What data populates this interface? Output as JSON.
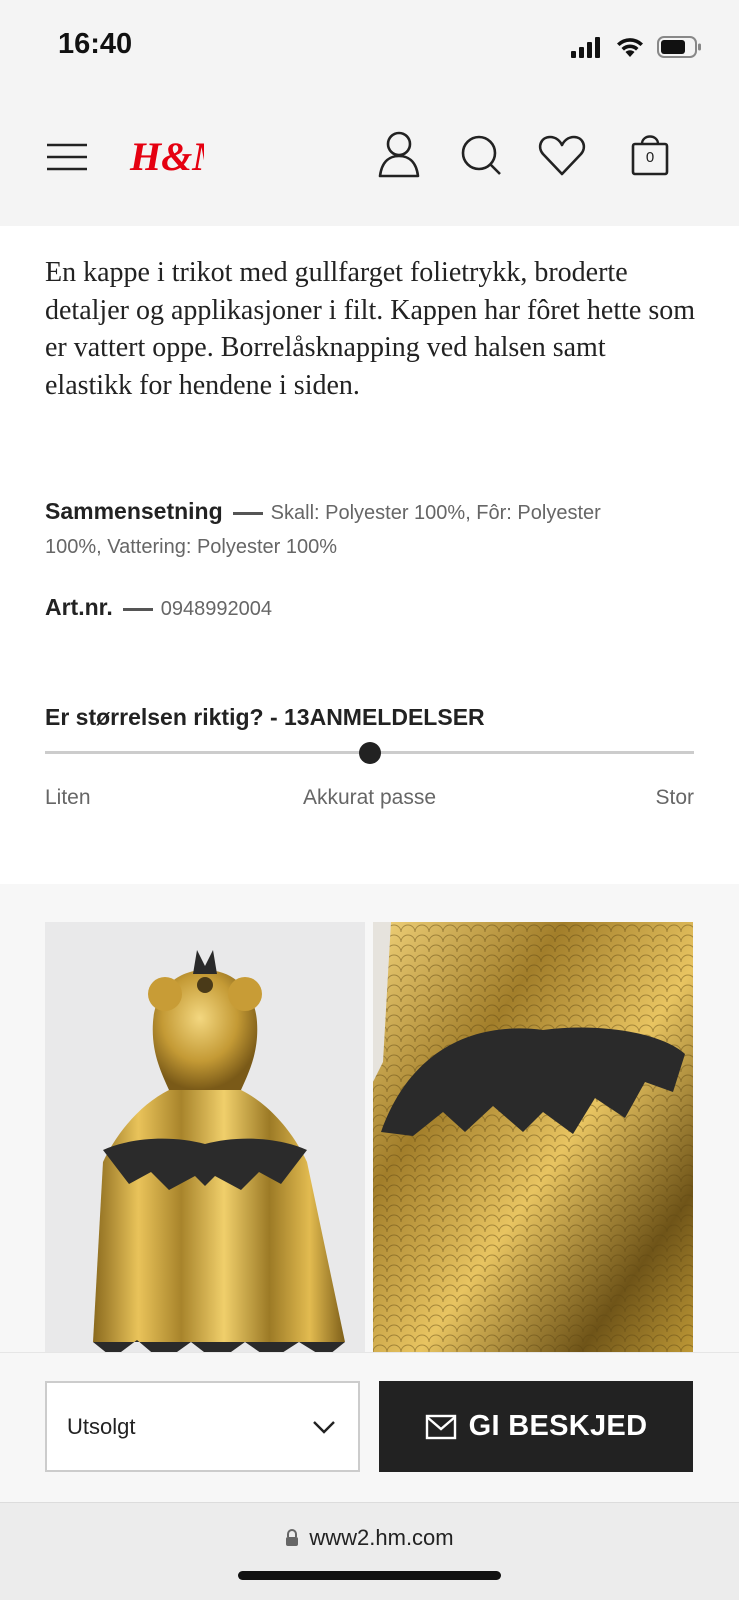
{
  "status_bar": {
    "time": "16:40"
  },
  "header": {
    "logo_text": "H&M",
    "cart_count": "0",
    "icons": [
      "menu-icon",
      "account-icon",
      "search-icon",
      "favorites-heart-icon",
      "shopping-bag-icon"
    ]
  },
  "product": {
    "description": "En kappe i trikot med gullfarget folietrykk, broderte detaljer og applikasjoner i filt. Kappen har fôret hette som er vattert oppe. Borrelåsknapping ved halsen samt elastikk for hendene i siden.",
    "composition": {
      "label": "Sammensetning",
      "value_line1": "Skall: Polyester 100%,  Fôr: Polyester",
      "value_line2": "100%,  Vattering: Polyester 100%"
    },
    "article": {
      "label": "Art.nr.",
      "value": "0948992004"
    }
  },
  "fit": {
    "title": "Er størrelsen riktig? - 13ANMELDELSER",
    "position": 0.5,
    "labels": {
      "small": "Liten",
      "right": "Akkurat passe",
      "large": "Stor"
    }
  },
  "purchase": {
    "size_value": "Utsolgt",
    "notify_label": "GI BESKJED"
  },
  "browser": {
    "url": "www2.hm.com"
  },
  "colors": {
    "brand_red": "#e50010",
    "dark": "#222222",
    "gold": "#c9a23a"
  }
}
